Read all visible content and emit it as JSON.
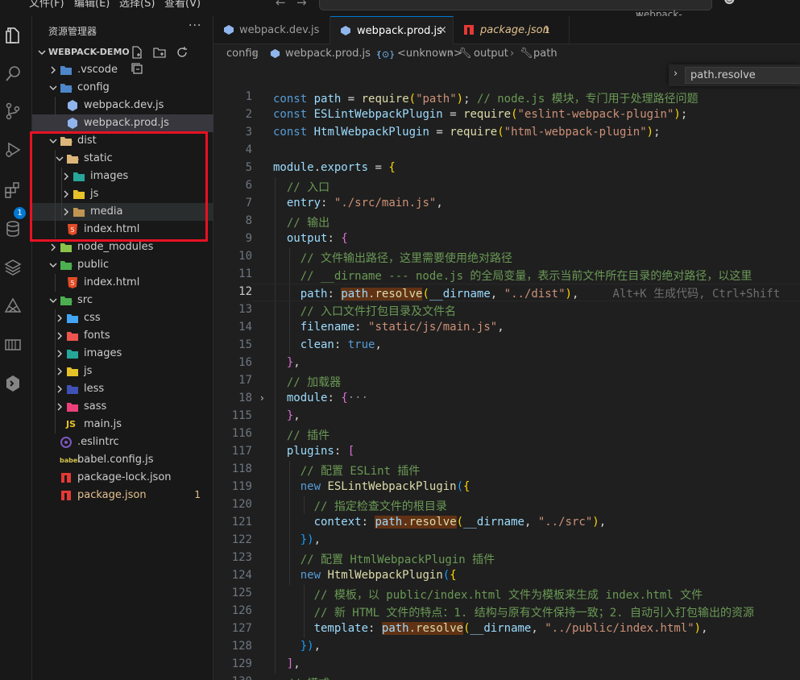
{
  "titlebar": {
    "menu": [
      "文件(F)",
      "编辑(E)",
      "选择(S)",
      "查看(V)",
      "···"
    ],
    "search_text": "webpack-demo"
  },
  "activitybar": {
    "icons": [
      "explorer-icon",
      "search-icon",
      "source-control-icon",
      "run-debug-icon",
      "extensions-icon",
      "database-icon",
      "layers-icon",
      "git-graph-icon",
      "remote-icon",
      "extension-cube-icon"
    ],
    "extensions_badge": "1"
  },
  "sidebar": {
    "header": "资源管理器",
    "more": "···",
    "section_title": "WEBPACK-DEMO",
    "tree": [
      {
        "label": ".vscode",
        "depth": 0,
        "type": "folder",
        "open": false,
        "icon_color": "#4e86c9"
      },
      {
        "label": "config",
        "depth": 0,
        "type": "folder",
        "open": true,
        "icon_color": "#4e86c9"
      },
      {
        "label": "webpack.dev.js",
        "depth": 1,
        "type": "file",
        "icon_color": "#8fb5ec"
      },
      {
        "label": "webpack.prod.js",
        "depth": 1,
        "type": "file",
        "icon_color": "#8fb5ec",
        "selected": true
      },
      {
        "label": "dist",
        "depth": 0,
        "type": "folder",
        "open": true,
        "icon_color": "#dcb67a"
      },
      {
        "label": "static",
        "depth": 1,
        "type": "folder",
        "open": true,
        "icon_color": "#dcb67a"
      },
      {
        "label": "images",
        "depth": 2,
        "type": "folder",
        "open": false,
        "icon_color": "#26a69a"
      },
      {
        "label": "js",
        "depth": 2,
        "type": "folder",
        "open": false,
        "icon_color": "#e6c229"
      },
      {
        "label": "media",
        "depth": 2,
        "type": "folder",
        "open": false,
        "icon_color": "#c09553",
        "hover": true
      },
      {
        "label": "index.html",
        "depth": 1,
        "type": "file",
        "icon_color": "#e34c26"
      },
      {
        "label": "node_modules",
        "depth": 0,
        "type": "folder",
        "open": false,
        "icon_color": "#8bc34a"
      },
      {
        "label": "public",
        "depth": 0,
        "type": "folder",
        "open": true,
        "icon_color": "#4caf50"
      },
      {
        "label": "index.html",
        "depth": 1,
        "type": "file",
        "icon_color": "#e34c26"
      },
      {
        "label": "src",
        "depth": 0,
        "type": "folder",
        "open": true,
        "icon_color": "#4caf50"
      },
      {
        "label": "css",
        "depth": 1,
        "type": "folder",
        "open": false,
        "icon_color": "#42a5f5"
      },
      {
        "label": "fonts",
        "depth": 1,
        "type": "folder",
        "open": false,
        "icon_color": "#ef5350"
      },
      {
        "label": "images",
        "depth": 1,
        "type": "folder",
        "open": false,
        "icon_color": "#26a69a"
      },
      {
        "label": "js",
        "depth": 1,
        "type": "folder",
        "open": false,
        "icon_color": "#e6c229"
      },
      {
        "label": "less",
        "depth": 1,
        "type": "folder",
        "open": false,
        "icon_color": "#3f51b5"
      },
      {
        "label": "sass",
        "depth": 1,
        "type": "folder",
        "open": false,
        "icon_color": "#ec407a"
      },
      {
        "label": "main.js",
        "depth": 1,
        "type": "file",
        "icon_text": "JS",
        "icon_color": "#e6c229"
      },
      {
        "label": ".eslintrc",
        "depth": 0,
        "type": "file",
        "icon_color": "#7e57c2"
      },
      {
        "label": "babel.config.js",
        "depth": 0,
        "type": "file",
        "icon_text": "babel",
        "icon_color": "#d4c44a"
      },
      {
        "label": "package-lock.json",
        "depth": 0,
        "type": "file",
        "icon_color": "#e53935"
      },
      {
        "label": "package.json",
        "depth": 0,
        "type": "file",
        "icon_color": "#e53935",
        "modified": true,
        "count": "1"
      }
    ]
  },
  "tabs": [
    {
      "label": "webpack.dev.js",
      "active": false
    },
    {
      "label": "webpack.prod.js",
      "active": true
    },
    {
      "label": "package.json",
      "active": false,
      "modified": true,
      "count": "1"
    }
  ],
  "breadcrumb": [
    "config",
    "webpack.prod.js",
    "<unknown>",
    "output",
    "path"
  ],
  "find_widget": {
    "value": "path.resolve"
  },
  "editor": {
    "current_line": "12",
    "inline_hint": "Alt+K 生成代码, Ctrl+Shift",
    "lines": [
      {
        "n": "1",
        "text": "const path = require(\"path\"); // node.js 模块，专门用于处理路径问题"
      },
      {
        "n": "2",
        "text": "const ESLintWebpackPlugin = require(\"eslint-webpack-plugin\");"
      },
      {
        "n": "3",
        "text": "const HtmlWebpackPlugin = require(\"html-webpack-plugin\");"
      },
      {
        "n": "4",
        "text": ""
      },
      {
        "n": "5",
        "text": "module.exports = {"
      },
      {
        "n": "6",
        "text": "  // 入口"
      },
      {
        "n": "7",
        "text": "  entry: \"./src/main.js\","
      },
      {
        "n": "8",
        "text": "  // 输出"
      },
      {
        "n": "9",
        "text": "  output: {"
      },
      {
        "n": "10",
        "text": "    // 文件输出路径，这里需要使用绝对路径"
      },
      {
        "n": "11",
        "text": "    // __dirname --- node.js 的全局变量，表示当前文件所在目录的绝对路径，以这里"
      },
      {
        "n": "12",
        "text": "    path: path.resolve(__dirname, \"../dist\"),"
      },
      {
        "n": "13",
        "text": "    // 入口文件打包目录及文件名"
      },
      {
        "n": "14",
        "text": "    filename: \"static/js/main.js\","
      },
      {
        "n": "15",
        "text": "    clean: true,"
      },
      {
        "n": "16",
        "text": "  },"
      },
      {
        "n": "17",
        "text": "  // 加载器"
      },
      {
        "n": "18",
        "text": "  module: {···"
      },
      {
        "n": "115",
        "text": "  },"
      },
      {
        "n": "116",
        "text": "  // 插件"
      },
      {
        "n": "117",
        "text": "  plugins: ["
      },
      {
        "n": "118",
        "text": "    // 配置 ESLint 插件"
      },
      {
        "n": "119",
        "text": "    new ESLintWebpackPlugin({"
      },
      {
        "n": "120",
        "text": "      // 指定检查文件的根目录"
      },
      {
        "n": "121",
        "text": "      context: path.resolve(__dirname, \"../src\"),"
      },
      {
        "n": "122",
        "text": "    }),"
      },
      {
        "n": "123",
        "text": "    // 配置 HtmlWebpackPlugin 插件"
      },
      {
        "n": "124",
        "text": "    new HtmlWebpackPlugin({"
      },
      {
        "n": "125",
        "text": "      // 模板，以 public/index.html 文件为模板来生成 index.html 文件"
      },
      {
        "n": "126",
        "text": "      // 新 HTML 文件的特点：1. 结构与原有文件保持一致；2. 自动引入打包输出的资源"
      },
      {
        "n": "127",
        "text": "      template: path.resolve(__dirname, \"../public/index.html\"),"
      },
      {
        "n": "128",
        "text": "    }),"
      },
      {
        "n": "129",
        "text": "  ],"
      },
      {
        "n": "130",
        "text": "  // 模式"
      }
    ]
  },
  "colors": {
    "accent": "#0078d4",
    "annotation_box": "#e81123",
    "modified": "#e2c08d"
  }
}
